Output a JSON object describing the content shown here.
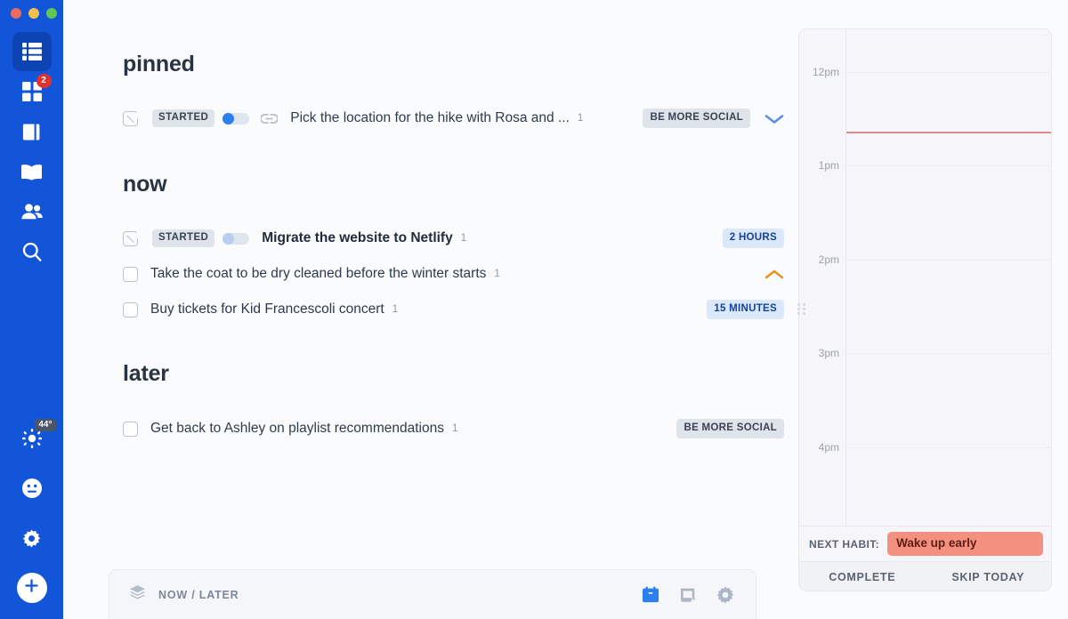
{
  "window": {
    "traffic_lights": [
      "close",
      "minimize",
      "zoom"
    ]
  },
  "sidebar": {
    "accent_color": "#1355d8",
    "top_items": [
      {
        "icon": "list-view-icon",
        "name": "tasks",
        "active": true
      },
      {
        "icon": "grid-view-icon",
        "name": "boards",
        "active": false,
        "badge": "2"
      },
      {
        "icon": "notebook-icon",
        "name": "notes",
        "active": false
      },
      {
        "icon": "open-book-icon",
        "name": "journal",
        "active": false
      },
      {
        "icon": "people-icon",
        "name": "people",
        "active": false
      },
      {
        "icon": "search-icon",
        "name": "search",
        "active": false
      }
    ],
    "bottom_items": [
      {
        "icon": "sun-icon",
        "name": "weather",
        "badge": "44°"
      },
      {
        "icon": "mood-neutral-icon",
        "name": "mood"
      },
      {
        "icon": "gear-icon",
        "name": "settings"
      }
    ],
    "add_button": {
      "icon": "plus-icon",
      "name": "add"
    }
  },
  "main": {
    "sections": [
      {
        "title": "pinned",
        "tasks": [
          {
            "checkbox_state": "folded",
            "started_label": "STARTED",
            "toggle": "on",
            "has_link": true,
            "title": "Pick the location for the hike with Rosa and ...",
            "count": "1",
            "bold": false,
            "tag": "BE MORE SOCIAL",
            "tag_type": "social",
            "chevron": "down",
            "chevron_color": "#5b8dd9"
          }
        ]
      },
      {
        "title": "now",
        "tasks": [
          {
            "checkbox_state": "folded",
            "started_label": "STARTED",
            "toggle": "on",
            "has_link": false,
            "title": "Migrate the website to Netlify",
            "count": "1",
            "bold": true,
            "tag": "2 HOURS",
            "tag_type": "time",
            "chevron": "none"
          },
          {
            "checkbox_state": "empty",
            "started_label": "",
            "toggle": "none",
            "has_link": false,
            "title": "Take the coat to be dry cleaned before the winter starts",
            "count": "1",
            "bold": false,
            "tag": "",
            "tag_type": "none",
            "chevron": "up",
            "chevron_color": "#e3951e"
          },
          {
            "checkbox_state": "empty",
            "started_label": "",
            "toggle": "none",
            "has_link": false,
            "title": "Buy tickets for Kid Francescoli concert",
            "count": "1",
            "bold": false,
            "tag": "15 MINUTES",
            "tag_type": "time",
            "chevron": "none"
          }
        ]
      },
      {
        "title": "later",
        "tasks": [
          {
            "checkbox_state": "empty",
            "started_label": "",
            "toggle": "none",
            "has_link": false,
            "title": "Get back to Ashley on playlist recommendations",
            "count": "1",
            "bold": false,
            "tag": "BE MORE SOCIAL",
            "tag_type": "social",
            "chevron": "none"
          }
        ]
      }
    ]
  },
  "bottom_bar": {
    "stack_icon": "layers-icon",
    "label": "NOW / LATER",
    "icons": [
      {
        "name": "calendar-icon",
        "color": "#2b7fef"
      },
      {
        "name": "note-scroll-icon",
        "color": "#aeb6c3"
      },
      {
        "name": "gear-icon",
        "color": "#aeb6c3"
      }
    ]
  },
  "calendar": {
    "hours": [
      "12pm",
      "1pm",
      "2pm",
      "3pm",
      "4pm"
    ],
    "current_time_line_color": "#df8b8f",
    "habit": {
      "label": "NEXT HABIT:",
      "name": "Wake up early",
      "chip_color": "#f49080",
      "complete_label": "COMPLETE",
      "skip_label": "SKIP TODAY"
    }
  }
}
